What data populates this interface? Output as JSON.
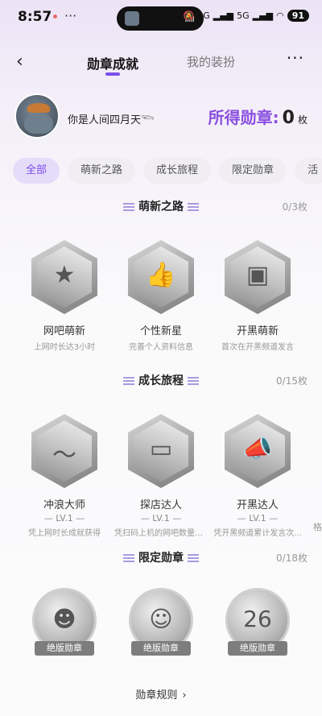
{
  "status": {
    "time": "8:57",
    "more": "···",
    "net1": "5G",
    "net2": "5G",
    "battery": "91"
  },
  "nav": {
    "back": "‹",
    "tab_active": "勋章成就",
    "tab_inactive": "我的装扮",
    "more": "···"
  },
  "profile": {
    "nickname": "你是人间四月天𓆝",
    "earned_label": "所得勋章:",
    "earned_count": "0",
    "earned_unit": "枚"
  },
  "filters": [
    "全部",
    "萌新之路",
    "成长旅程",
    "限定勋章",
    "活"
  ],
  "sections": {
    "newbie": {
      "title": "萌新之路",
      "count": "0/3枚",
      "badges": [
        {
          "name": "网吧萌新",
          "desc": "上网时长达3小时",
          "icon": "star-icon"
        },
        {
          "name": "个性新星",
          "desc": "完善个人资料信息",
          "icon": "thumbs-up-icon"
        },
        {
          "name": "开黑萌新",
          "desc": "首次在开黑频道发言",
          "icon": "robot-icon"
        }
      ]
    },
    "growth": {
      "title": "成长旅程",
      "count": "0/15枚",
      "badges": [
        {
          "name": "冲浪大师",
          "lv": "— LV.1 —",
          "desc": "凭上网时长成就获得",
          "icon": "surf-icon"
        },
        {
          "name": "探店达人",
          "lv": "— LV.1 —",
          "desc": "凭扫码上机的网吧数量获得",
          "icon": "monitor-icon"
        },
        {
          "name": "开黑达人",
          "lv": "— LV.1 —",
          "desc": "凭开黑频道累计发言次...",
          "icon": "megaphone-icon"
        }
      ],
      "edge": "格"
    },
    "limited": {
      "title": "限定勋章",
      "count": "0/18枚",
      "badges": [
        {
          "ribbon": "绝版勋章",
          "icon": "mascot-icon"
        },
        {
          "ribbon": "绝版勋章",
          "icon": "mascot-clock-icon"
        },
        {
          "ribbon": "绝版勋章",
          "icon": "year-2026-icon"
        }
      ]
    }
  },
  "rules": {
    "label": "勋章规则",
    "chevron": "›"
  },
  "glyphs": {
    "star": "★",
    "thumb": "👍",
    "robot": "▣",
    "surf": "〜",
    "monitor": "▭",
    "megaphone": "📣",
    "mascot": "☻",
    "mascot2": "☺",
    "year": "26"
  }
}
